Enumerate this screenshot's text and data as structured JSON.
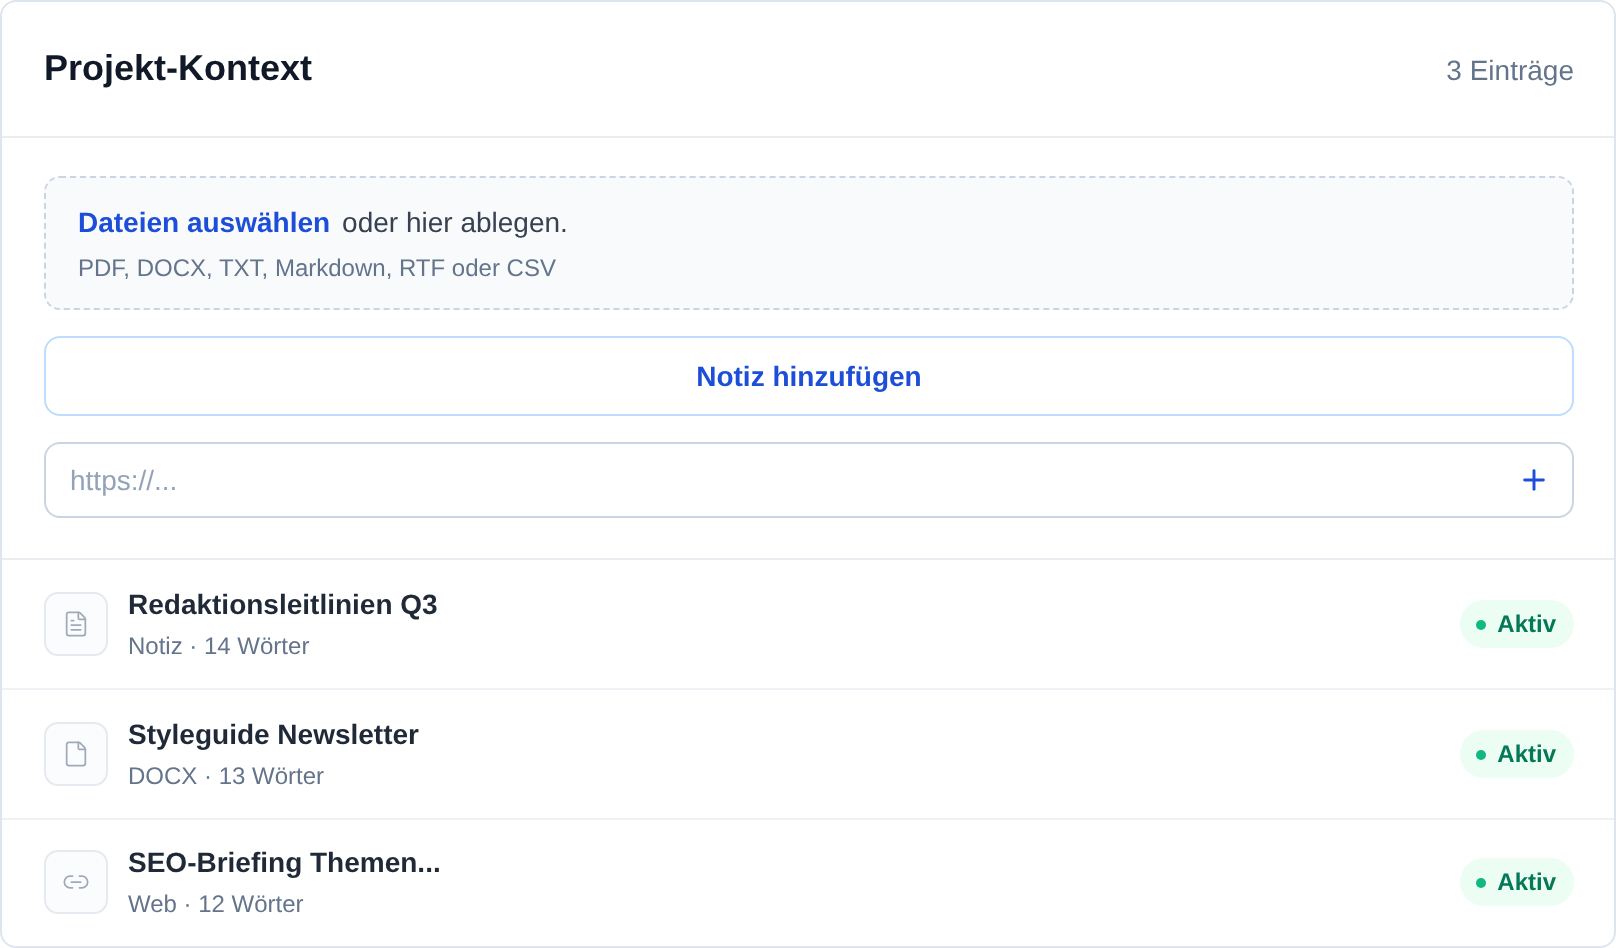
{
  "header": {
    "title": "Projekt-Kontext",
    "count": "3 Einträge"
  },
  "dropzone": {
    "link": "Dateien auswählen",
    "text": "oder hier ablegen.",
    "formats": "PDF, DOCX, TXT, Markdown, RTF oder CSV"
  },
  "note_button": "Notiz hinzufügen",
  "url_field": {
    "placeholder": "https://..."
  },
  "items": [
    {
      "kind": "note",
      "title": "Redaktionsleitlinien Q3",
      "meta": "Notiz · 14 Wörter",
      "status": "Aktiv"
    },
    {
      "kind": "file",
      "title": "Styleguide Newsletter",
      "meta": "DOCX · 13 Wörter",
      "status": "Aktiv"
    },
    {
      "kind": "link",
      "title": "SEO-Briefing Themen...",
      "meta": "Web · 12 Wörter",
      "status": "Aktiv"
    }
  ]
}
